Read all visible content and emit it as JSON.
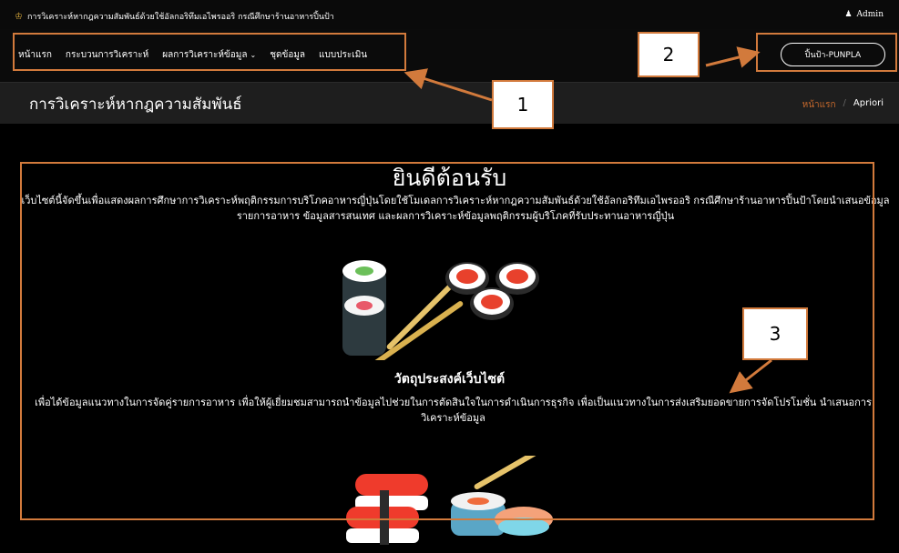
{
  "topbar": {
    "title": "การวิเคราะห์หากฎความสัมพันธ์ด้วยใช้อัลกอริทึมเอไพรออริ กรณีศึกษาร้านอาหารปิ้นป้า",
    "title_icon": "cake-icon",
    "user_icon": "user-icon",
    "user_label": "Admin"
  },
  "nav": {
    "items": [
      "หน้าแรก",
      "กระบวนการวิเคราะห์",
      "ผลการวิเคราะห์ข้อมูล",
      "ชุดข้อมูล",
      "แบบประเมิน"
    ],
    "cta": "ปิ้นป้า-PUNPLA"
  },
  "page_header": {
    "title": "การวิเคราะห์หากฎความสัมพันธ์",
    "breadcrumb": [
      "หน้าแรก",
      "Apriori"
    ]
  },
  "content": {
    "welcome": "ยินดีต้อนรับ",
    "intro": "เว็บไซต์นี้จัดขึ้นเพื่อแสดงผลการศึกษาการวิเคราะห์พฤติกรรมการบริโภคอาหารญี่ปุ่นโดยใช้โมเดลการวิเคราะห์หากฎความสัมพันธ์ด้วยใช้อัลกอริทึมเอไพรออริ กรณีศึกษาร้านอาหารปิ้นป้าโดยนำเสนอข้อมูลรายการอาหาร ข้อมูลสารสนเทศ และผลการวิเคราะห์ข้อมูลพฤติกรรมผู้บริโภคที่รับประทานอาหารญี่ปุ่น",
    "goal_title": "วัตถุประสงค์เว็บไซต์",
    "goal_text": "เพื่อได้ข้อมูลแนวทางในการจัดคู่รายการอาหาร เพื่อให้ผู้เยี่ยมชมสามารถนำข้อมูลไปช่วยในการตัดสินใจในการดำเนินการธุรกิจ เพื่อเป็นแนวทางในการส่งเสริมยอดขายการจัดโปรโมชั่น นำเสนอการวิเคราะห์ข้อมูล"
  },
  "annotations": [
    "1",
    "2",
    "3"
  ],
  "colors": {
    "accent": "#c7692c",
    "annotation": "#d27a3c",
    "background": "#000000"
  }
}
